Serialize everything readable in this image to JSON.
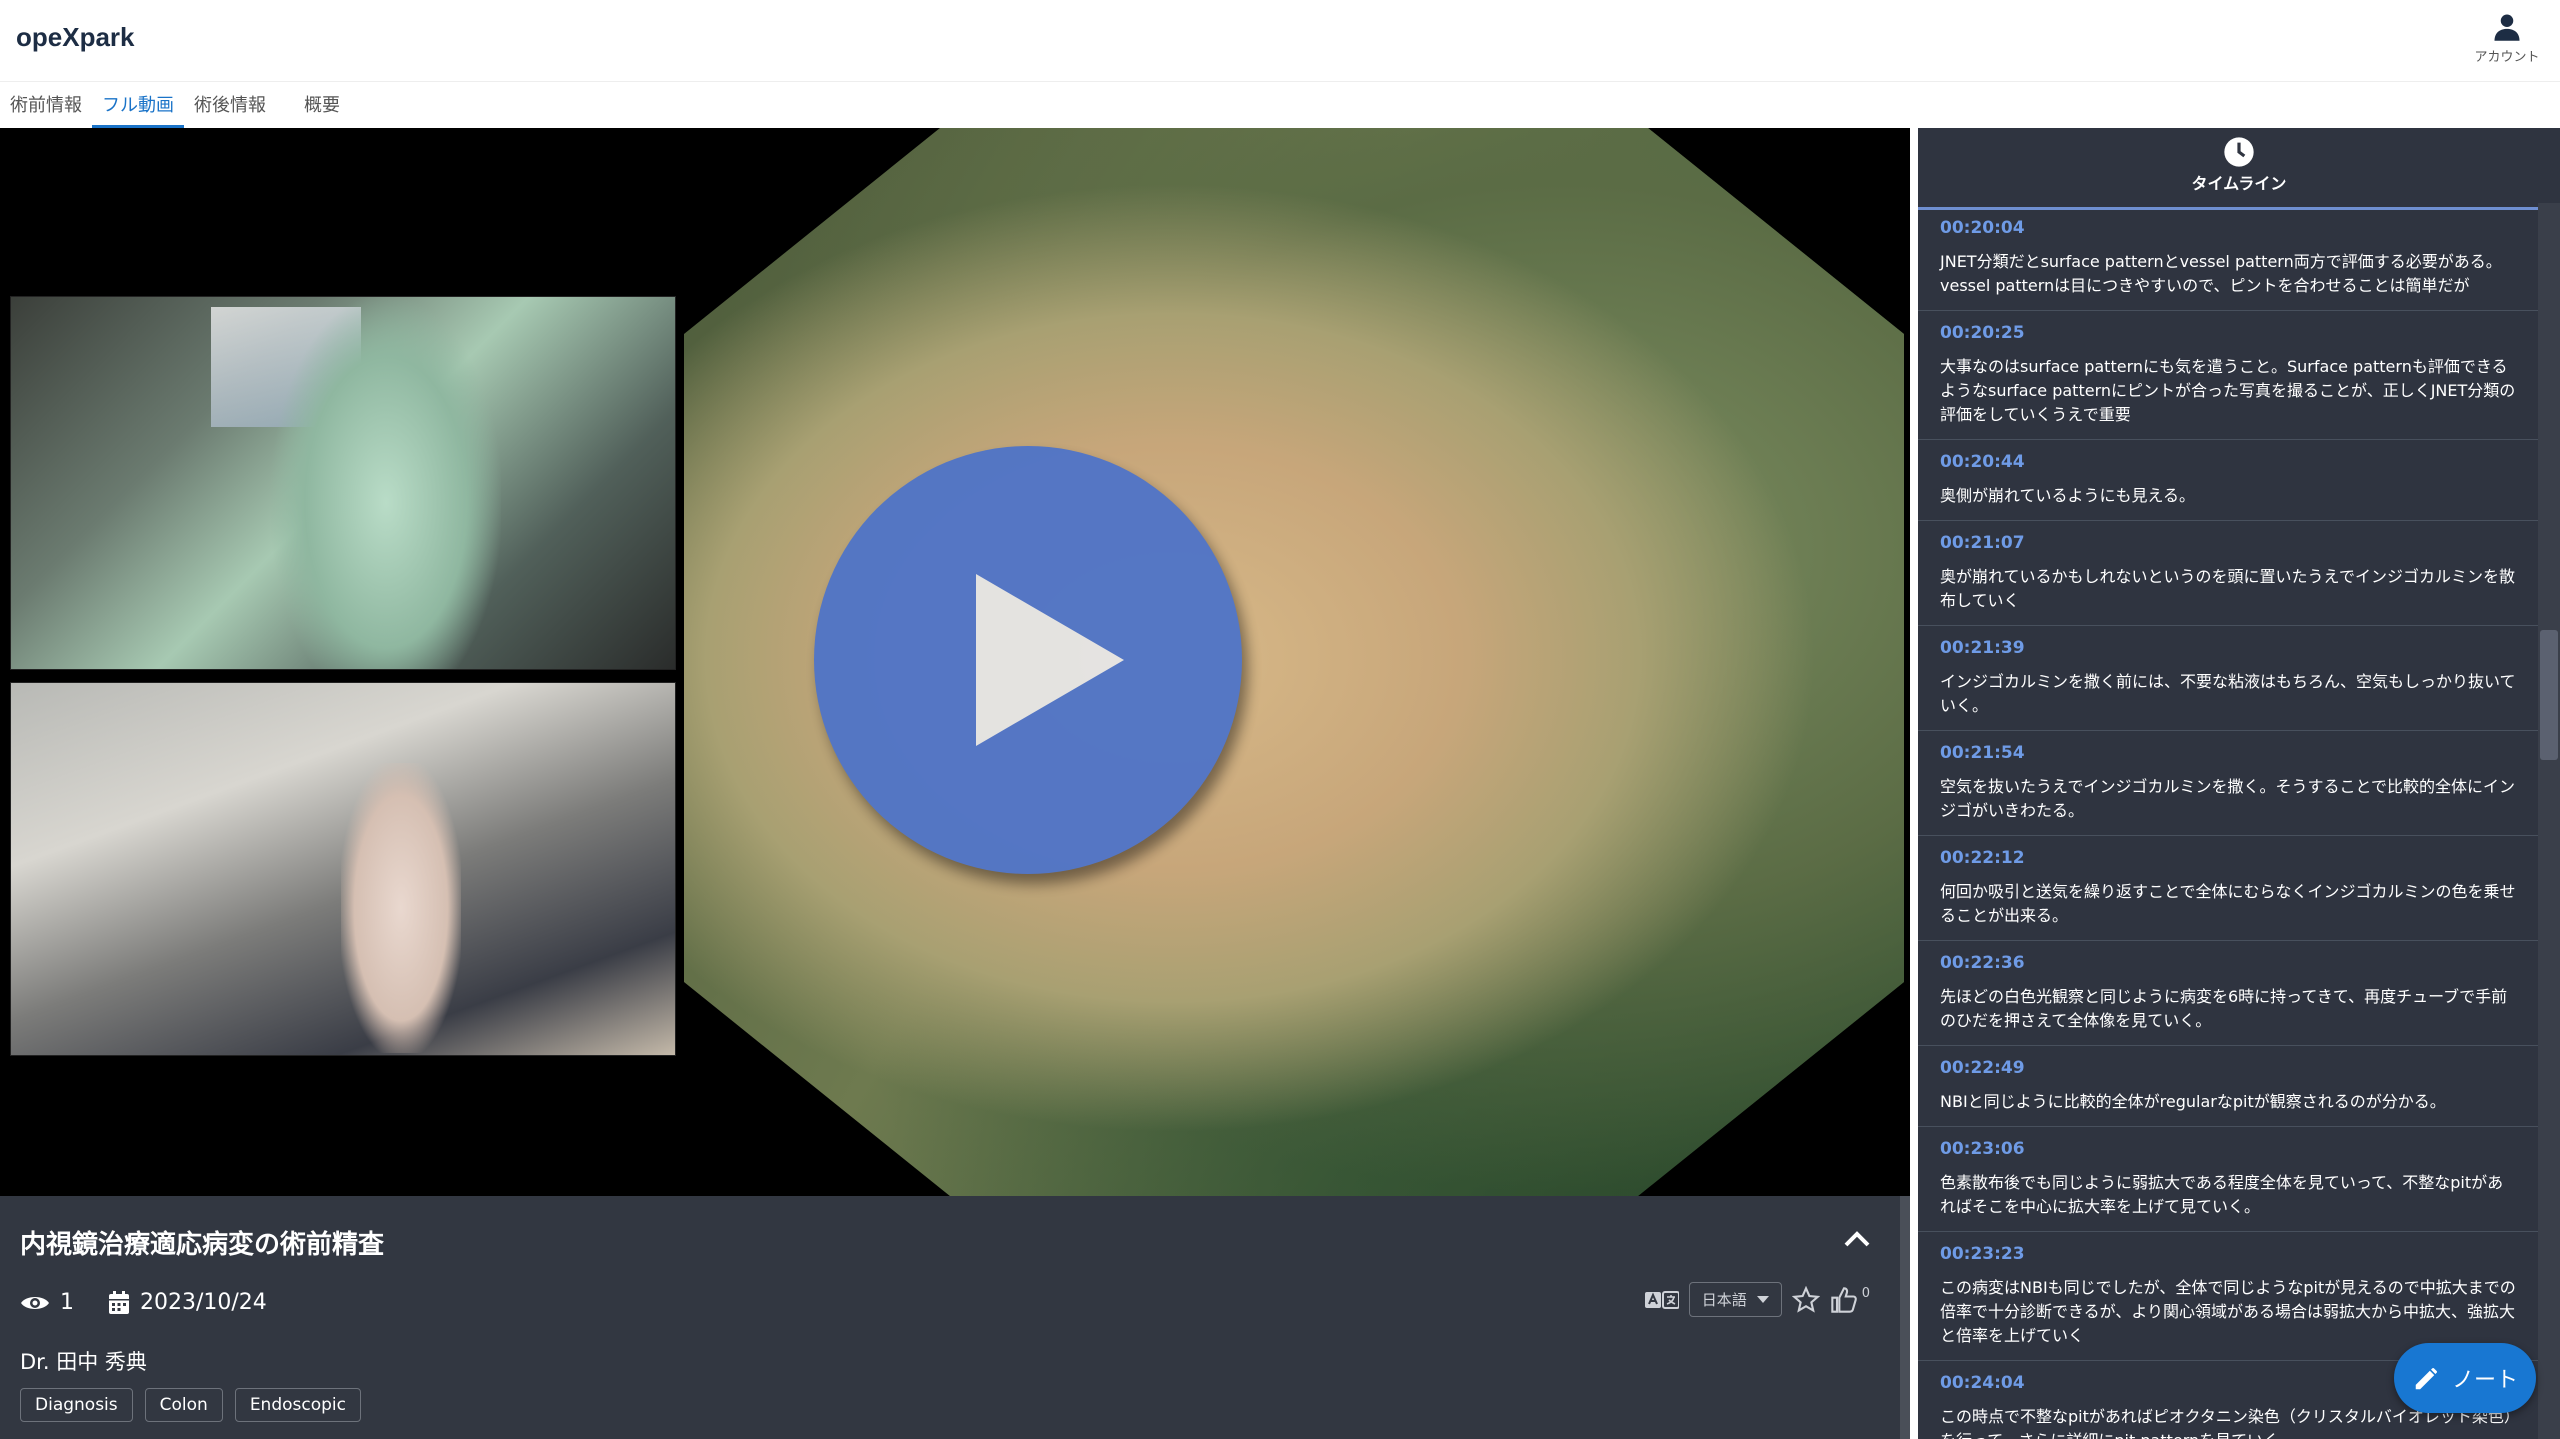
{
  "header": {
    "brand": "opeXpark",
    "account_label": "アカウント"
  },
  "tabs": [
    {
      "label": "術前情報"
    },
    {
      "label": "フル動画"
    },
    {
      "label": "術後情報"
    },
    {
      "label": "概要"
    }
  ],
  "active_tab": "フル動画",
  "video": {
    "title": "内視鏡治療適応病変の術前精査"
  },
  "info": {
    "views": "1",
    "date": "2023/10/24",
    "doctor": "Dr. 田中 秀典",
    "tags": [
      "Diagnosis",
      "Colon",
      "Endoscopic"
    ],
    "language": "日本語",
    "likes": "0"
  },
  "timeline": {
    "title": "タイムライン",
    "items": [
      {
        "time": "00:20:04",
        "text": "JNET分類だとsurface patternとvessel pattern両方で評価する必要がある。vessel patternは目につきやすいので、ピントを合わせることは簡単だが"
      },
      {
        "time": "00:20:25",
        "text": "大事なのはsurface patternにも気を遣うこと。Surface patternも評価できるようなsurface patternにピントが合った写真を撮ることが、正しくJNET分類の評価をしていくうえで重要"
      },
      {
        "time": "00:20:44",
        "text": "奥側が崩れているようにも見える。"
      },
      {
        "time": "00:21:07",
        "text": "奥が崩れているかもしれないというのを頭に置いたうえでインジゴカルミンを散布していく"
      },
      {
        "time": "00:21:39",
        "text": "インジゴカルミンを撒く前には、不要な粘液はもちろん、空気もしっかり抜いていく。"
      },
      {
        "time": "00:21:54",
        "text": "空気を抜いたうえでインジゴカルミンを撒く。そうすることで比較的全体にインジゴがいきわたる。"
      },
      {
        "time": "00:22:12",
        "text": "何回か吸引と送気を繰り返すことで全体にむらなくインジゴカルミンの色を乗せることが出来る。"
      },
      {
        "time": "00:22:36",
        "text": "先ほどの白色光観察と同じように病変を6時に持ってきて、再度チューブで手前のひだを押さえて全体像を見ていく。"
      },
      {
        "time": "00:22:49",
        "text": "NBIと同じように比較的全体がregularなpitが観察されるのが分かる。"
      },
      {
        "time": "00:23:06",
        "text": "色素散布後でも同じように弱拡大である程度全体を見ていって、不整なpitがあればそこを中心に拡大率を上げて見ていく。"
      },
      {
        "time": "00:23:23",
        "text": "この病変はNBIも同じでしたが、全体で同じようなpitが見えるので中拡大までの倍率で十分診断できるが、より関心領域がある場合は弱拡大から中拡大、強拡大と倍率を上げていく"
      },
      {
        "time": "00:24:04",
        "text": "この時点で不整なpitがあればピオクタニン染色（クリスタルバイオレット染色）を行って、さらに詳細にpit patternを見ていく"
      }
    ]
  },
  "note_button": {
    "label": "ノート"
  },
  "colors": {
    "accent": "#1a73c8",
    "timestamp": "#6f9be6",
    "play_button": "#4f74c8",
    "panel_bg": "#2f3440"
  },
  "icons": [
    "account-icon",
    "play-icon",
    "collapse-chevron-icon",
    "eye-icon",
    "calendar-icon",
    "translate-icon",
    "chevron-down-icon",
    "star-icon",
    "thumbs-up-icon",
    "clock-icon",
    "pencil-icon"
  ]
}
